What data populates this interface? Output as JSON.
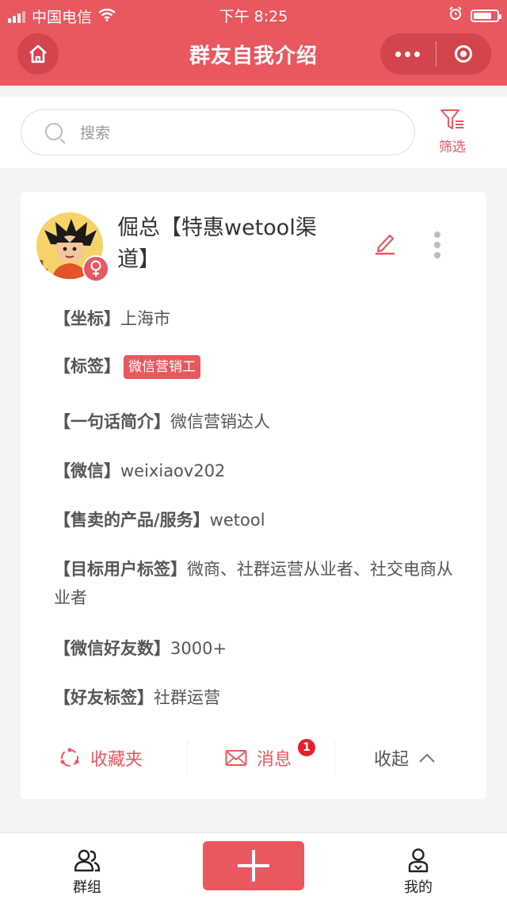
{
  "status_bar": {
    "carrier": "中国电信",
    "time": "下午 8:25"
  },
  "nav": {
    "title": "群友自我介绍"
  },
  "search": {
    "placeholder": "搜索",
    "filter_label": "筛选"
  },
  "profile": {
    "name": "倔总【特惠wetool渠道】",
    "fields": {
      "location": {
        "label": "【坐标】",
        "value": "上海市"
      },
      "tags": {
        "label": "【标签】",
        "items": [
          "微信营销工"
        ]
      },
      "intro": {
        "label": "【一句话简介】",
        "value": "微信营销达人"
      },
      "wechat": {
        "label": "【微信】",
        "value": "weixiaov202"
      },
      "products": {
        "label": "【售卖的产品/服务】",
        "value": "wetool"
      },
      "target_users": {
        "label": "【目标用户标签】",
        "value": "微商、社群运营从业者、社交电商从业者"
      },
      "friend_count": {
        "label": "【微信好友数】",
        "value": "3000+"
      },
      "friend_tags": {
        "label": "【好友标签】",
        "value": "社群运营"
      }
    },
    "actions": {
      "favorite": "收藏夹",
      "message": "消息",
      "message_badge": "1",
      "collapse": "收起"
    }
  },
  "tabbar": {
    "groups": "群组",
    "mine": "我的"
  },
  "colors": {
    "accent": "#e9575f",
    "badge": "#e8202b"
  }
}
